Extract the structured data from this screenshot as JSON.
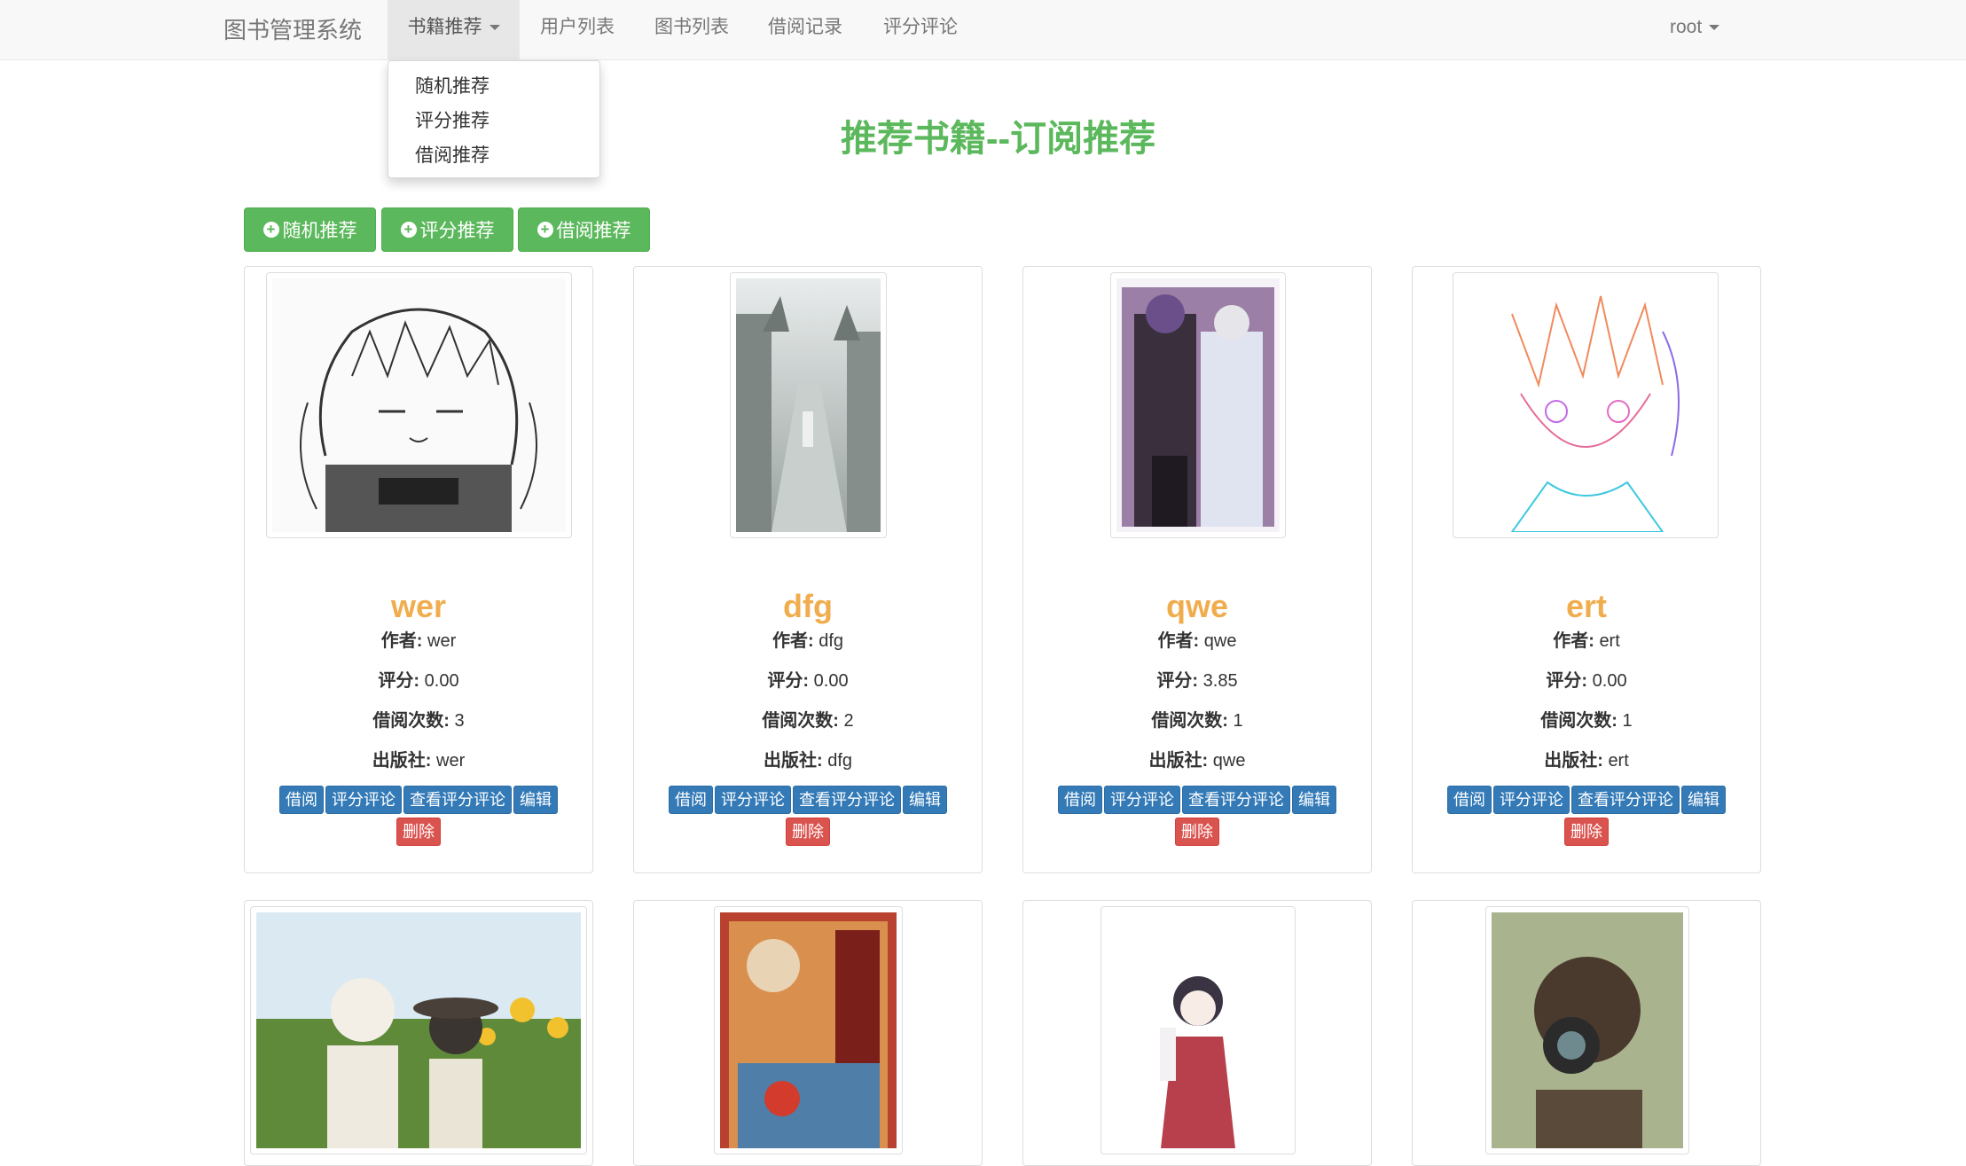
{
  "navbar": {
    "brand": "图书管理系统",
    "items": [
      {
        "label": "书籍推荐"
      },
      {
        "label": "用户列表"
      },
      {
        "label": "图书列表"
      },
      {
        "label": "借阅记录"
      },
      {
        "label": "评分评论"
      }
    ],
    "user": "root"
  },
  "dropdown": {
    "items": [
      {
        "label": "随机推荐"
      },
      {
        "label": "评分推荐"
      },
      {
        "label": "借阅推荐"
      }
    ]
  },
  "page": {
    "title": "推荐书籍--订阅推荐"
  },
  "filter_buttons": [
    {
      "label": "随机推荐",
      "icon": "plus-circle-icon"
    },
    {
      "label": "评分推荐",
      "icon": "plus-circle-icon"
    },
    {
      "label": "借阅推荐",
      "icon": "plus-circle-icon"
    }
  ],
  "labels": {
    "author": "作者:",
    "rating": "评分:",
    "borrow_count": "借阅次数:",
    "publisher": "出版社:"
  },
  "actions": {
    "borrow": "借阅",
    "rate": "评分评论",
    "view_reviews": "查看评分评论",
    "edit": "编辑",
    "delete": "删除"
  },
  "books": [
    {
      "title": "wer",
      "author": "wer",
      "rating": "0.00",
      "borrow_count": "3",
      "publisher": "wer"
    },
    {
      "title": "dfg",
      "author": "dfg",
      "rating": "0.00",
      "borrow_count": "2",
      "publisher": "dfg"
    },
    {
      "title": "qwe",
      "author": "qwe",
      "rating": "3.85",
      "borrow_count": "1",
      "publisher": "qwe"
    },
    {
      "title": "ert",
      "author": "ert",
      "rating": "0.00",
      "borrow_count": "1",
      "publisher": "ert"
    }
  ],
  "colors": {
    "success": "#5cb85c",
    "primary": "#337ab7",
    "danger": "#d9534f",
    "warning": "#f0ad4e"
  }
}
